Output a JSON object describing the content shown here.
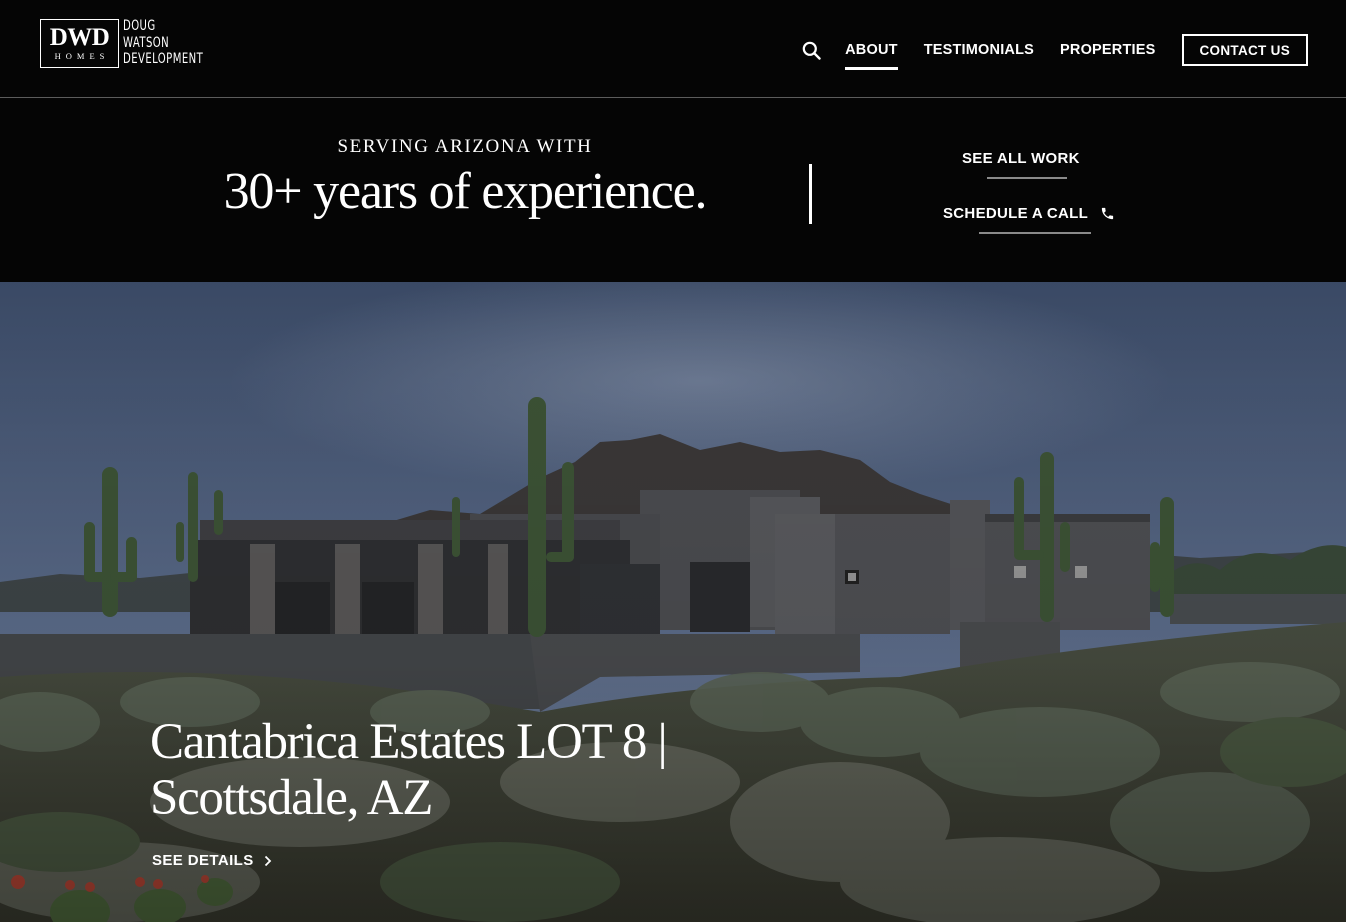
{
  "brand": {
    "monogram": "DWD",
    "homes": "HOMES",
    "name_lines": [
      "DOUG",
      "WATSON",
      "DEVELOPMENT"
    ]
  },
  "nav": {
    "search_icon": "search-icon",
    "items": [
      {
        "label": "ABOUT",
        "active": true
      },
      {
        "label": "TESTIMONIALS",
        "active": false
      },
      {
        "label": "PROPERTIES",
        "active": false
      }
    ],
    "contact_label": "CONTACT US"
  },
  "band": {
    "eyebrow": "SERVING ARIZONA WITH",
    "headline": "30+ years of experience.",
    "cta_work": "SEE ALL WORK",
    "cta_call": "SCHEDULE A CALL",
    "call_icon": "phone-icon"
  },
  "hero": {
    "title_line1": "Cantabrica Estates LOT 8 |",
    "title_line2": "Scottsdale, AZ",
    "details_label": "SEE DETAILS",
    "details_icon": "chevron-right-icon"
  },
  "colors": {
    "background": "#050505",
    "text": "#ffffff",
    "divider": "#5c5c5c"
  }
}
